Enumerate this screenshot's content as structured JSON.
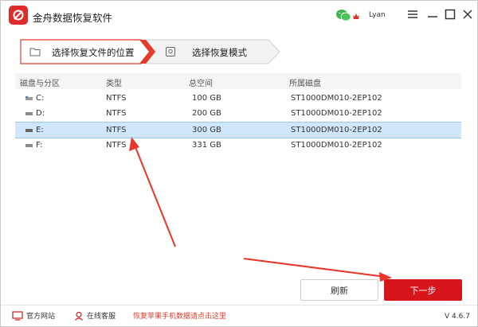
{
  "app": {
    "title": "金舟数据恢复软件",
    "user": "Lyan",
    "version": "V 4.6.7"
  },
  "steps": [
    {
      "label": "选择恢复文件的位置",
      "active": true
    },
    {
      "label": "选择恢复模式",
      "active": false
    }
  ],
  "table": {
    "headers": [
      "磁盘与分区",
      "类型",
      "总空间",
      "所属磁盘"
    ],
    "rows": [
      {
        "drive": "C:",
        "type": "NTFS",
        "size": "100 GB",
        "disk": "ST1000DM010-2EP102",
        "selected": false
      },
      {
        "drive": "D:",
        "type": "NTFS",
        "size": "200 GB",
        "disk": "ST1000DM010-2EP102",
        "selected": false
      },
      {
        "drive": "E:",
        "type": "NTFS",
        "size": "300 GB",
        "disk": "ST1000DM010-2EP102",
        "selected": true
      },
      {
        "drive": "F:",
        "type": "NTFS",
        "size": "331 GB",
        "disk": "ST1000DM010-2EP102",
        "selected": false
      }
    ]
  },
  "buttons": {
    "refresh": "刷新",
    "next": "下一步"
  },
  "footer": {
    "website": "官方网站",
    "service": "在线客服",
    "promo": "恢复苹果手机数据请点击这里"
  },
  "colors": {
    "accent": "#d7161b",
    "selection": "#cfe6fb",
    "annotation": "#e8362a"
  }
}
